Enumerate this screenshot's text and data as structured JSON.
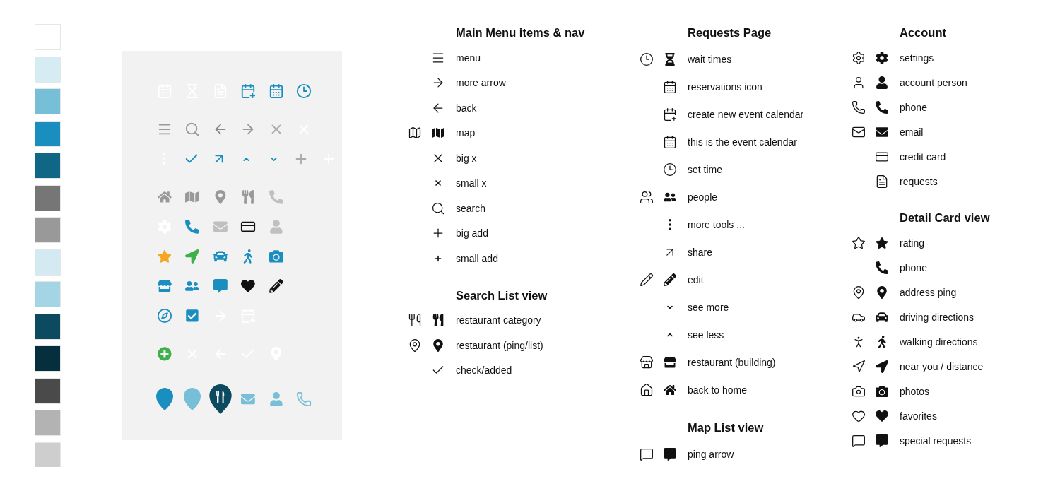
{
  "swatches": [
    {
      "color": "#ffffff"
    },
    {
      "color": "#d6ecf3"
    },
    {
      "color": "#76bfd6"
    },
    {
      "color": "#1a8fbf"
    },
    {
      "color": "#0f6685"
    },
    {
      "color": "#767676"
    },
    {
      "color": "#999999"
    },
    {
      "color": "#d4eaf2"
    },
    {
      "color": "#a3d5e5"
    },
    {
      "color": "#0b4a5f"
    },
    {
      "color": "#062f3d"
    },
    {
      "color": "#4a4a4a"
    },
    {
      "color": "#b3b3b3"
    },
    {
      "color": "#cecece"
    }
  ],
  "panel": {
    "groups": [
      [
        [
          {
            "kind": "calendar",
            "filled": false,
            "color": "#ffffff"
          },
          {
            "kind": "hourglass",
            "filled": false,
            "color": "#ffffff"
          },
          {
            "kind": "document",
            "filled": false,
            "color": "#ffffff"
          },
          {
            "kind": "calendar-plus",
            "filled": false,
            "color": "#1a8fbf"
          },
          {
            "kind": "calendar",
            "filled": false,
            "color": "#1a8fbf"
          },
          {
            "kind": "clock",
            "filled": false,
            "color": "#1a8fbf"
          }
        ]
      ],
      [
        [
          {
            "kind": "menu",
            "color": "#999999"
          },
          {
            "kind": "search",
            "filled": false,
            "color": "#999999"
          },
          {
            "kind": "arrow-left",
            "filled": false,
            "color": "#888888"
          },
          {
            "kind": "arrow-right",
            "filled": false,
            "color": "#999999"
          },
          {
            "kind": "close",
            "color": "#aaaaaa"
          },
          {
            "kind": "close",
            "color": "#ffffff"
          }
        ],
        [
          {
            "kind": "more",
            "filled": true,
            "color": "#ffffff"
          },
          {
            "kind": "check",
            "filled": false,
            "color": "#1a8fbf"
          },
          {
            "kind": "arrow-up-right",
            "filled": false,
            "color": "#1a8fbf"
          },
          {
            "kind": "chevron-up",
            "filled": false,
            "color": "#1a8fbf"
          },
          {
            "kind": "chevron-down",
            "filled": false,
            "color": "#1a8fbf"
          },
          {
            "kind": "plus",
            "color": "#aaaaaa"
          },
          {
            "kind": "plus",
            "color": "#ffffff"
          }
        ]
      ],
      [
        [
          {
            "kind": "home",
            "filled": true,
            "color": "#999999"
          },
          {
            "kind": "map",
            "filled": true,
            "color": "#999999"
          },
          {
            "kind": "pin",
            "filled": true,
            "color": "#999999"
          },
          {
            "kind": "utensils",
            "filled": true,
            "color": "#999999"
          },
          {
            "kind": "phone",
            "filled": true,
            "color": "#c0c0c0"
          }
        ],
        [
          {
            "kind": "settings",
            "filled": true,
            "color": "#ffffff"
          },
          {
            "kind": "phone",
            "filled": true,
            "color": "#1a8fbf"
          },
          {
            "kind": "mail",
            "filled": true,
            "color": "#c0c0c0"
          },
          {
            "kind": "credit-card",
            "filled": false,
            "color": "#111111"
          },
          {
            "kind": "user",
            "filled": true,
            "color": "#c0c0c0"
          }
        ],
        [
          {
            "kind": "star",
            "filled": true,
            "color": "#f5a623"
          },
          {
            "kind": "navigation",
            "filled": true,
            "color": "#3db04b"
          },
          {
            "kind": "car",
            "filled": true,
            "color": "#1a8fbf"
          },
          {
            "kind": "walking",
            "filled": true,
            "color": "#1a8fbf"
          },
          {
            "kind": "camera",
            "filled": true,
            "color": "#1a8fbf"
          }
        ],
        [
          {
            "kind": "store",
            "filled": true,
            "color": "#1a8fbf"
          },
          {
            "kind": "people",
            "filled": true,
            "color": "#1a8fbf"
          },
          {
            "kind": "comment",
            "filled": true,
            "color": "#1a8fbf"
          },
          {
            "kind": "heart",
            "filled": true,
            "color": "#111111"
          },
          {
            "kind": "pencil",
            "filled": true,
            "color": "#111111"
          }
        ],
        [
          {
            "kind": "compass",
            "filled": false,
            "color": "#1a8fbf"
          },
          {
            "kind": "checkbox",
            "filled": true,
            "color": "#1a8fbf"
          },
          {
            "kind": "arrow-right",
            "filled": false,
            "color": "#ffffff"
          },
          {
            "kind": "calendar-plus",
            "filled": false,
            "color": "#ffffff"
          }
        ]
      ],
      [
        [
          {
            "kind": "plus-circle",
            "filled": true,
            "color": "#3db04b"
          },
          {
            "kind": "close",
            "color": "#ffffff"
          },
          {
            "kind": "arrow-left",
            "filled": false,
            "color": "#ffffff"
          },
          {
            "kind": "check",
            "filled": false,
            "color": "#ffffff"
          },
          {
            "kind": "pin",
            "filled": true,
            "color": "#ffffff"
          }
        ]
      ],
      [
        [
          {
            "kind": "drop",
            "filled": true,
            "color": "#1a8fbf"
          },
          {
            "kind": "drop",
            "filled": true,
            "color": "#76bfd6"
          },
          {
            "kind": "drop-utensils",
            "filled": true,
            "color": "#0b4a5f"
          },
          {
            "kind": "mail",
            "filled": true,
            "color": "#76bfd6"
          },
          {
            "kind": "user",
            "filled": true,
            "color": "#76bfd6"
          },
          {
            "kind": "phone",
            "filled": false,
            "color": "#76bfd6"
          }
        ]
      ]
    ]
  },
  "columns": [
    {
      "sections": [
        {
          "title": "Main Menu items & nav",
          "rows": [
            {
              "label": "menu",
              "icons": [
                {
                  "kind": "menu"
                }
              ]
            },
            {
              "label": "more arrow",
              "icons": [
                {
                  "kind": "arrow-right",
                  "filled": false
                }
              ]
            },
            {
              "label": "back",
              "icons": [
                {
                  "kind": "arrow-left",
                  "filled": false
                }
              ]
            },
            {
              "label": "map",
              "icons": [
                {
                  "kind": "map",
                  "filled": false
                },
                {
                  "kind": "map",
                  "filled": true
                }
              ]
            },
            {
              "label": "big x",
              "icons": [
                {
                  "kind": "close"
                }
              ]
            },
            {
              "label": "small x",
              "icons": [
                {
                  "kind": "close-small"
                }
              ]
            },
            {
              "label": "search",
              "icons": [
                {
                  "kind": "search",
                  "filled": false
                }
              ]
            },
            {
              "label": "big add",
              "icons": [
                {
                  "kind": "plus"
                }
              ]
            },
            {
              "label": "small add",
              "icons": [
                {
                  "kind": "plus-small"
                }
              ]
            }
          ]
        },
        {
          "title": "Search List view",
          "rows": [
            {
              "label": "restaurant category",
              "icons": [
                {
                  "kind": "utensils",
                  "filled": false
                },
                {
                  "kind": "utensils",
                  "filled": true
                }
              ]
            },
            {
              "label": "restaurant (ping/list)",
              "icons": [
                {
                  "kind": "pin",
                  "filled": false
                },
                {
                  "kind": "pin",
                  "filled": true
                }
              ]
            },
            {
              "label": "check/added",
              "icons": [
                {
                  "kind": "check",
                  "filled": false
                }
              ]
            }
          ]
        }
      ]
    },
    {
      "sections": [
        {
          "title": "Requests Page",
          "rows": [
            {
              "label": "wait times",
              "icons": [
                {
                  "kind": "clock",
                  "filled": false
                },
                {
                  "kind": "hourglass",
                  "filled": true
                }
              ]
            },
            {
              "label": "reservations icon",
              "icons": [
                {
                  "kind": "calendar",
                  "filled": false
                }
              ]
            },
            {
              "label": "create new event calendar",
              "icons": [
                {
                  "kind": "calendar-plus",
                  "filled": false
                }
              ]
            },
            {
              "label": "this is the event calendar",
              "icons": [
                {
                  "kind": "calendar",
                  "filled": false
                }
              ]
            },
            {
              "label": "set time",
              "icons": [
                {
                  "kind": "clock",
                  "filled": false
                }
              ]
            },
            {
              "label": "people",
              "icons": [
                {
                  "kind": "people",
                  "filled": false
                },
                {
                  "kind": "people",
                  "filled": true
                }
              ]
            },
            {
              "label": "more tools ...",
              "icons": [
                {
                  "kind": "more",
                  "filled": true
                }
              ]
            },
            {
              "label": "share",
              "icons": [
                {
                  "kind": "arrow-up-right",
                  "filled": false
                }
              ]
            },
            {
              "label": "edit",
              "icons": [
                {
                  "kind": "pencil",
                  "filled": false
                },
                {
                  "kind": "pencil",
                  "filled": true
                }
              ]
            },
            {
              "label": "see more",
              "icons": [
                {
                  "kind": "chevron-down",
                  "filled": false
                }
              ]
            },
            {
              "label": "see less",
              "icons": [
                {
                  "kind": "chevron-up",
                  "filled": false
                }
              ]
            },
            {
              "label": "restaurant (building)",
              "icons": [
                {
                  "kind": "store",
                  "filled": false
                },
                {
                  "kind": "store",
                  "filled": true
                }
              ]
            },
            {
              "label": "back to home",
              "icons": [
                {
                  "kind": "home",
                  "filled": false
                },
                {
                  "kind": "home",
                  "filled": true
                }
              ]
            }
          ]
        },
        {
          "title": "Map List view",
          "rows": [
            {
              "label": "ping arrow",
              "icons": [
                {
                  "kind": "comment",
                  "filled": false
                },
                {
                  "kind": "comment",
                  "filled": true
                }
              ]
            }
          ]
        }
      ]
    },
    {
      "sections": [
        {
          "title": "Account",
          "rows": [
            {
              "label": "settings",
              "icons": [
                {
                  "kind": "settings",
                  "filled": false
                },
                {
                  "kind": "settings",
                  "filled": true
                }
              ]
            },
            {
              "label": "account person",
              "icons": [
                {
                  "kind": "user",
                  "filled": false
                },
                {
                  "kind": "user",
                  "filled": true
                }
              ]
            },
            {
              "label": "phone",
              "icons": [
                {
                  "kind": "phone",
                  "filled": false
                },
                {
                  "kind": "phone",
                  "filled": true
                }
              ]
            },
            {
              "label": "email",
              "icons": [
                {
                  "kind": "mail",
                  "filled": false
                },
                {
                  "kind": "mail",
                  "filled": true
                }
              ]
            },
            {
              "label": "credit card",
              "icons": [
                {
                  "kind": "credit-card",
                  "filled": false
                }
              ]
            },
            {
              "label": "requests",
              "icons": [
                {
                  "kind": "document",
                  "filled": false
                }
              ]
            }
          ]
        },
        {
          "title": "Detail Card view",
          "rows": [
            {
              "label": "rating",
              "icons": [
                {
                  "kind": "star",
                  "filled": false
                },
                {
                  "kind": "star",
                  "filled": true
                }
              ]
            },
            {
              "label": "phone",
              "icons": [
                {
                  "kind": "phone",
                  "filled": true
                }
              ]
            },
            {
              "label": "address ping",
              "icons": [
                {
                  "kind": "pin",
                  "filled": false
                },
                {
                  "kind": "pin",
                  "filled": true
                }
              ]
            },
            {
              "label": "driving directions",
              "icons": [
                {
                  "kind": "car",
                  "filled": false
                },
                {
                  "kind": "car",
                  "filled": true
                }
              ]
            },
            {
              "label": "walking directions",
              "icons": [
                {
                  "kind": "walking",
                  "filled": false
                },
                {
                  "kind": "walking",
                  "filled": true
                }
              ]
            },
            {
              "label": "near you / distance",
              "icons": [
                {
                  "kind": "navigation",
                  "filled": false
                },
                {
                  "kind": "navigation",
                  "filled": true
                }
              ]
            },
            {
              "label": "photos",
              "icons": [
                {
                  "kind": "camera",
                  "filled": false
                },
                {
                  "kind": "camera",
                  "filled": true
                }
              ]
            },
            {
              "label": "favorites",
              "icons": [
                {
                  "kind": "heart",
                  "filled": false
                },
                {
                  "kind": "heart",
                  "filled": true
                }
              ]
            },
            {
              "label": "special requests",
              "icons": [
                {
                  "kind": "comment",
                  "filled": false
                },
                {
                  "kind": "comment",
                  "filled": true
                }
              ]
            }
          ]
        }
      ]
    }
  ]
}
